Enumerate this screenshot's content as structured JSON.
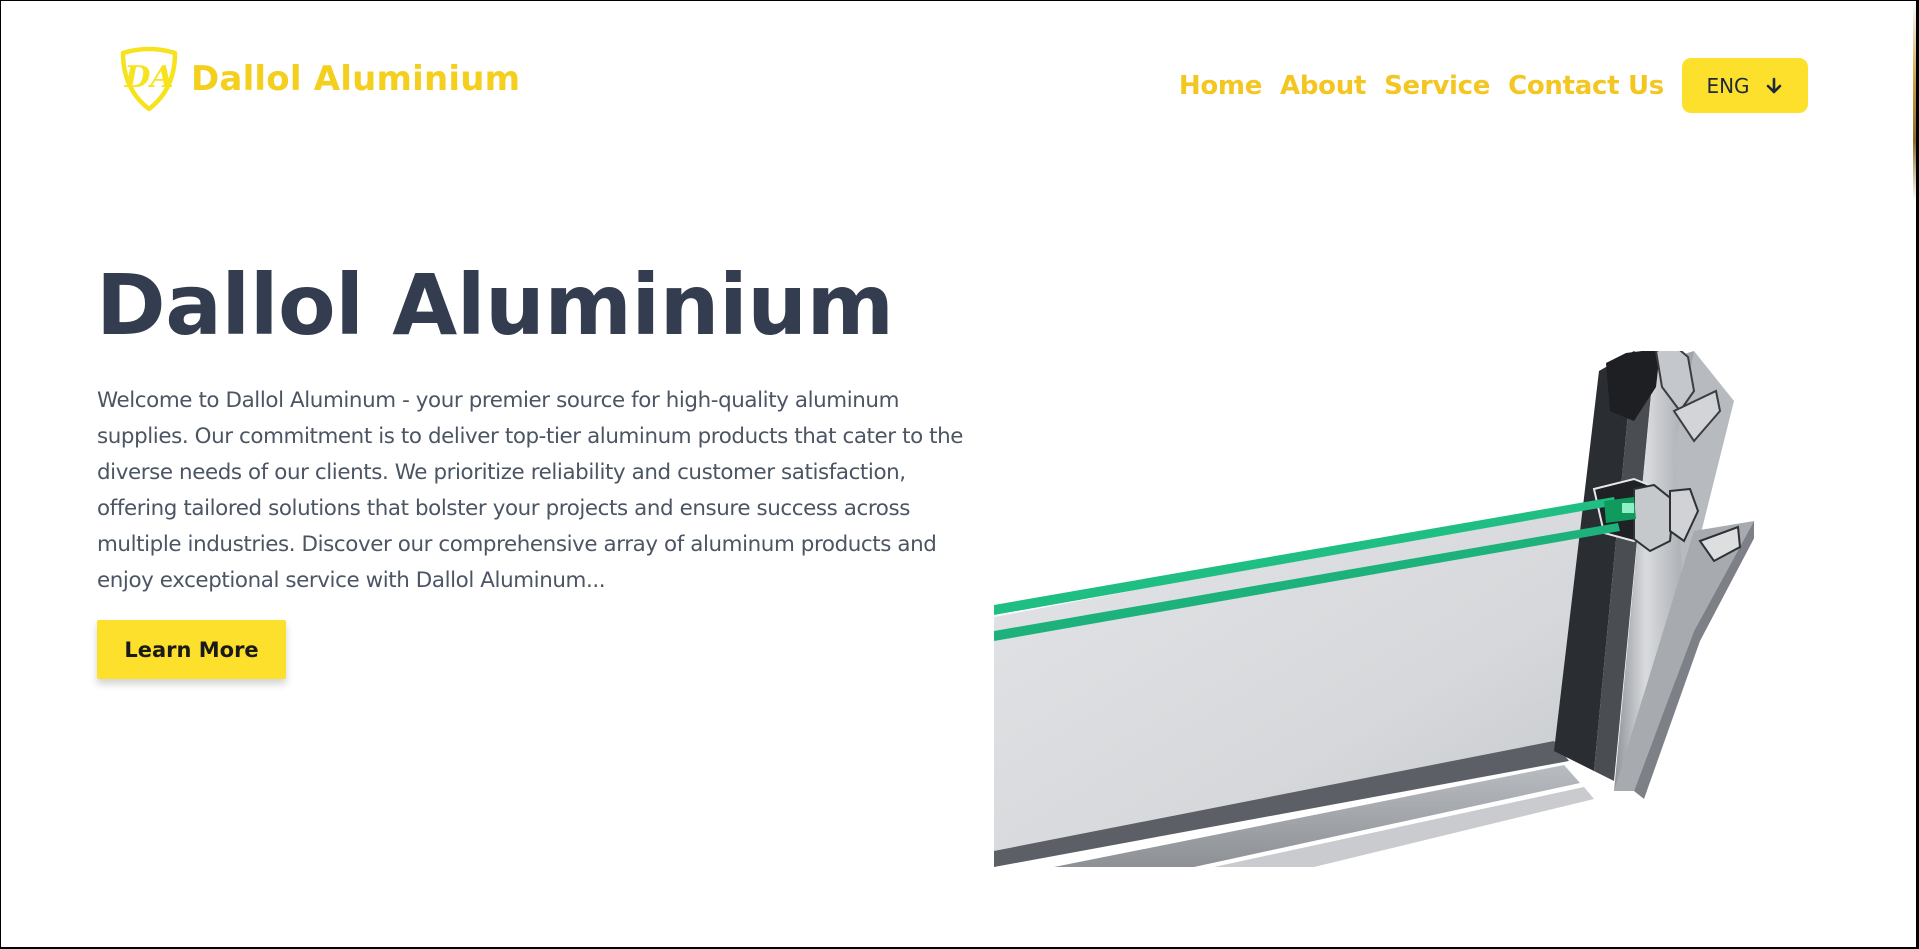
{
  "brand": {
    "name": "Dallol Aluminium",
    "logo_initials": "DA",
    "color": "#f4cf1e"
  },
  "nav": {
    "links": [
      "Home",
      "About",
      "Service",
      "Contact Us"
    ],
    "language": {
      "selected": "ENG",
      "icon": "arrow-down-icon"
    }
  },
  "hero": {
    "title": "Dallol Aluminium",
    "description": "Welcome to Dallol Aluminum - your premier source for high-quality aluminum supplies. Our commitment is to deliver top-tier aluminum products that cater to the diverse needs of our clients. We prioritize reliability and customer satisfaction, offering tailored solutions that bolster your projects and ensure success across multiple industries. Discover our comprehensive array of aluminum products and enjoy exceptional service with Dallol Aluminum...",
    "cta_label": "Learn More"
  },
  "colors": {
    "accent": "#fde02c",
    "nav_text": "#f4c622",
    "heading": "#333d4f",
    "body_text": "#4b5563",
    "glass_edge": "#1fbf84"
  }
}
